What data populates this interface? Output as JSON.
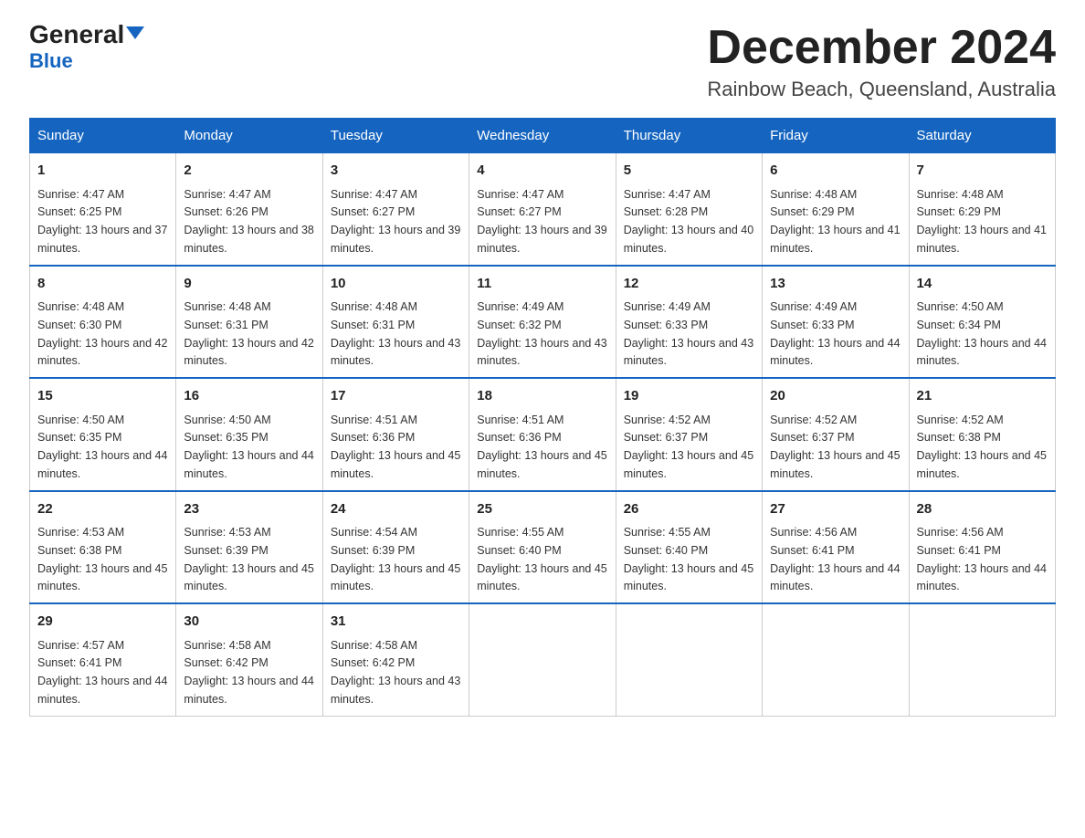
{
  "logo": {
    "name": "General",
    "name2": "Blue"
  },
  "header": {
    "month": "December 2024",
    "location": "Rainbow Beach, Queensland, Australia"
  },
  "days_of_week": [
    "Sunday",
    "Monday",
    "Tuesday",
    "Wednesday",
    "Thursday",
    "Friday",
    "Saturday"
  ],
  "weeks": [
    [
      {
        "day": "1",
        "sunrise": "4:47 AM",
        "sunset": "6:25 PM",
        "daylight": "13 hours and 37 minutes."
      },
      {
        "day": "2",
        "sunrise": "4:47 AM",
        "sunset": "6:26 PM",
        "daylight": "13 hours and 38 minutes."
      },
      {
        "day": "3",
        "sunrise": "4:47 AM",
        "sunset": "6:27 PM",
        "daylight": "13 hours and 39 minutes."
      },
      {
        "day": "4",
        "sunrise": "4:47 AM",
        "sunset": "6:27 PM",
        "daylight": "13 hours and 39 minutes."
      },
      {
        "day": "5",
        "sunrise": "4:47 AM",
        "sunset": "6:28 PM",
        "daylight": "13 hours and 40 minutes."
      },
      {
        "day": "6",
        "sunrise": "4:48 AM",
        "sunset": "6:29 PM",
        "daylight": "13 hours and 41 minutes."
      },
      {
        "day": "7",
        "sunrise": "4:48 AM",
        "sunset": "6:29 PM",
        "daylight": "13 hours and 41 minutes."
      }
    ],
    [
      {
        "day": "8",
        "sunrise": "4:48 AM",
        "sunset": "6:30 PM",
        "daylight": "13 hours and 42 minutes."
      },
      {
        "day": "9",
        "sunrise": "4:48 AM",
        "sunset": "6:31 PM",
        "daylight": "13 hours and 42 minutes."
      },
      {
        "day": "10",
        "sunrise": "4:48 AM",
        "sunset": "6:31 PM",
        "daylight": "13 hours and 43 minutes."
      },
      {
        "day": "11",
        "sunrise": "4:49 AM",
        "sunset": "6:32 PM",
        "daylight": "13 hours and 43 minutes."
      },
      {
        "day": "12",
        "sunrise": "4:49 AM",
        "sunset": "6:33 PM",
        "daylight": "13 hours and 43 minutes."
      },
      {
        "day": "13",
        "sunrise": "4:49 AM",
        "sunset": "6:33 PM",
        "daylight": "13 hours and 44 minutes."
      },
      {
        "day": "14",
        "sunrise": "4:50 AM",
        "sunset": "6:34 PM",
        "daylight": "13 hours and 44 minutes."
      }
    ],
    [
      {
        "day": "15",
        "sunrise": "4:50 AM",
        "sunset": "6:35 PM",
        "daylight": "13 hours and 44 minutes."
      },
      {
        "day": "16",
        "sunrise": "4:50 AM",
        "sunset": "6:35 PM",
        "daylight": "13 hours and 44 minutes."
      },
      {
        "day": "17",
        "sunrise": "4:51 AM",
        "sunset": "6:36 PM",
        "daylight": "13 hours and 45 minutes."
      },
      {
        "day": "18",
        "sunrise": "4:51 AM",
        "sunset": "6:36 PM",
        "daylight": "13 hours and 45 minutes."
      },
      {
        "day": "19",
        "sunrise": "4:52 AM",
        "sunset": "6:37 PM",
        "daylight": "13 hours and 45 minutes."
      },
      {
        "day": "20",
        "sunrise": "4:52 AM",
        "sunset": "6:37 PM",
        "daylight": "13 hours and 45 minutes."
      },
      {
        "day": "21",
        "sunrise": "4:52 AM",
        "sunset": "6:38 PM",
        "daylight": "13 hours and 45 minutes."
      }
    ],
    [
      {
        "day": "22",
        "sunrise": "4:53 AM",
        "sunset": "6:38 PM",
        "daylight": "13 hours and 45 minutes."
      },
      {
        "day": "23",
        "sunrise": "4:53 AM",
        "sunset": "6:39 PM",
        "daylight": "13 hours and 45 minutes."
      },
      {
        "day": "24",
        "sunrise": "4:54 AM",
        "sunset": "6:39 PM",
        "daylight": "13 hours and 45 minutes."
      },
      {
        "day": "25",
        "sunrise": "4:55 AM",
        "sunset": "6:40 PM",
        "daylight": "13 hours and 45 minutes."
      },
      {
        "day": "26",
        "sunrise": "4:55 AM",
        "sunset": "6:40 PM",
        "daylight": "13 hours and 45 minutes."
      },
      {
        "day": "27",
        "sunrise": "4:56 AM",
        "sunset": "6:41 PM",
        "daylight": "13 hours and 44 minutes."
      },
      {
        "day": "28",
        "sunrise": "4:56 AM",
        "sunset": "6:41 PM",
        "daylight": "13 hours and 44 minutes."
      }
    ],
    [
      {
        "day": "29",
        "sunrise": "4:57 AM",
        "sunset": "6:41 PM",
        "daylight": "13 hours and 44 minutes."
      },
      {
        "day": "30",
        "sunrise": "4:58 AM",
        "sunset": "6:42 PM",
        "daylight": "13 hours and 44 minutes."
      },
      {
        "day": "31",
        "sunrise": "4:58 AM",
        "sunset": "6:42 PM",
        "daylight": "13 hours and 43 minutes."
      },
      null,
      null,
      null,
      null
    ]
  ]
}
